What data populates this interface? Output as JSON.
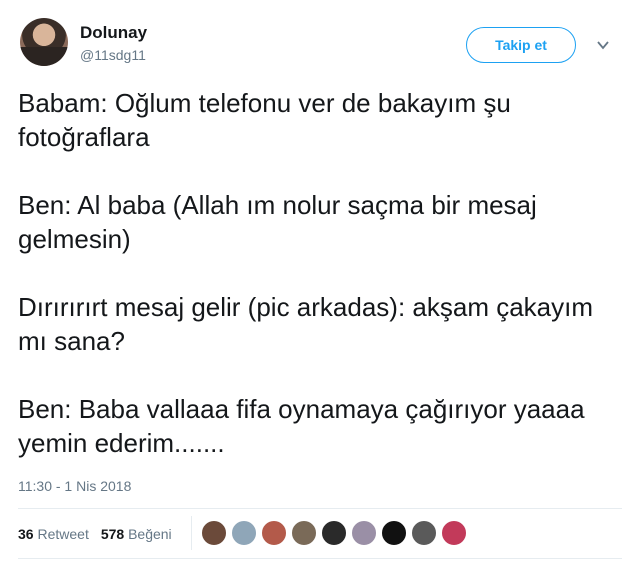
{
  "author": {
    "name": "Dolunay",
    "handle": "@11sdg11"
  },
  "follow_button": {
    "label": "Takip et"
  },
  "tweet": {
    "paragraphs": [
      "Babam: Oğlum telefonu ver de bakayım şu fotoğraflara",
      "Ben: Al baba (Allah ım nolur saçma bir mesaj gelmesin)",
      "Dırırırırt mesaj gelir (pic arkadas): akşam çakayım mı sana?",
      "Ben: Baba vallaaa fifa oynamaya çağırıyor yaaaa yemin ederim......."
    ],
    "timestamp": "11:30 - 1 Nis 2018"
  },
  "stats": {
    "retweet_count": "36",
    "retweet_label": "Retweet",
    "like_count": "578",
    "like_label": "Beğeni"
  },
  "likers": [
    {
      "color": "#6b4a3a"
    },
    {
      "color": "#8fa6b8"
    },
    {
      "color": "#b35a4a"
    },
    {
      "color": "#7a6a58"
    },
    {
      "color": "#2a2a2a"
    },
    {
      "color": "#9a8fa6"
    },
    {
      "color": "#111111"
    },
    {
      "color": "#5a5a5a"
    },
    {
      "color": "#c23a5a"
    }
  ],
  "colors": {
    "accent": "#1da1f2",
    "text": "#14171a",
    "secondary": "#657786"
  }
}
